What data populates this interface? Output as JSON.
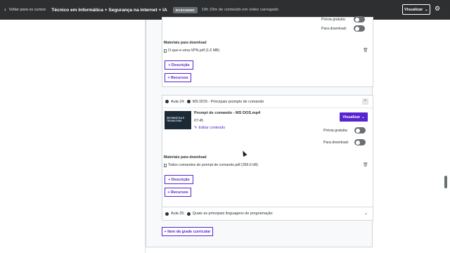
{
  "topbar": {
    "back_label": "Voltar para os cursos",
    "course_title": "Técnico em Informática + Segurança na internet + IA",
    "status_badge": "RASCUNHO",
    "loaded_text": "10h 23m de conteúdo em vídeo carregado",
    "view_button": "Visualizar",
    "view_chevron": "⌄",
    "settings_icon": "gear-icon"
  },
  "lecture_top": {
    "free_preview_label": "Prévia gratuita:",
    "download_label": "Para download:",
    "materials_title": "Materiais para download",
    "file_name": "O-que-e-uma-VPN.pdf (1.6 MB)",
    "description_button": "+ Descrição",
    "resources_button": "+ Recursos"
  },
  "lecture_24": {
    "number": "Aula 24:",
    "title": "MS DOS - Principais prompts de comando",
    "video_name": "Prompt de comando - MS DOS.mp4",
    "duration": "07:45",
    "edit_link": "Editar conteúdo",
    "view_button": "Visualizar",
    "view_chevron": "⌄",
    "free_preview_label": "Prévia gratuita:",
    "download_label": "Para download:",
    "materials_title": "Materiais para download",
    "file_name": "Todos comandos do prompt de comando.pdf (356.6 kB)",
    "description_button": "+ Descrição",
    "resources_button": "+ Recursos",
    "thumbnail_text": "INFORMÁTICA E TECNOLOGIA"
  },
  "lecture_25": {
    "number": "Aula 25:",
    "title": "Quais as principais linguagens de programação"
  },
  "add_curriculum_item": "+ Item da grade curricular"
}
